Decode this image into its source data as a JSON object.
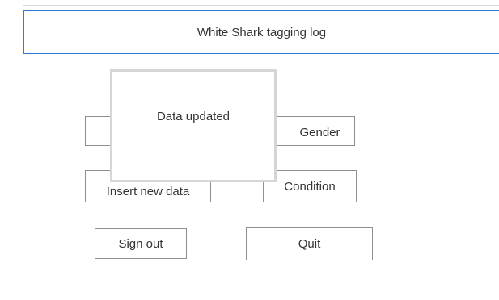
{
  "window": {
    "title": "White Shark tagging log"
  },
  "buttons": {
    "gender_label": "Gender",
    "insert_label": "Insert new data",
    "condition_label": "Condition",
    "signout_label": "Sign out",
    "quit_label": "Quit"
  },
  "popup": {
    "message": "Data updated"
  },
  "colors": {
    "title_border": "#2f7fd1",
    "button_border": "#8f8f8f",
    "popup_border": "#d6d6d6"
  }
}
